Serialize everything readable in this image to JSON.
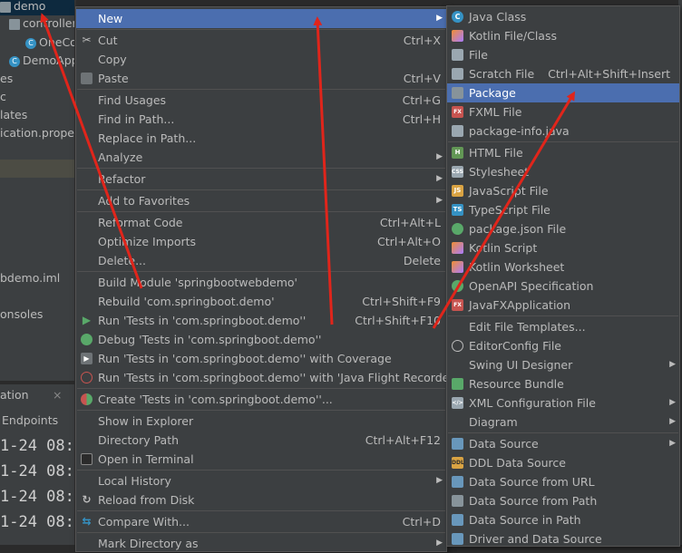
{
  "tree": {
    "rows": [
      {
        "label": "demo",
        "icon": "folder-icon"
      },
      {
        "label": "controller",
        "icon": "folder-icon"
      },
      {
        "label": "OneCo",
        "icon": "class-icon"
      },
      {
        "label": "DemoApp",
        "icon": "spring-class-icon"
      },
      {
        "label": "es",
        "icon": ""
      },
      {
        "label": "c",
        "icon": ""
      },
      {
        "label": "lates",
        "icon": ""
      },
      {
        "label": "ication.proper",
        "icon": ""
      },
      {
        "label": "bdemo.iml",
        "icon": ""
      },
      {
        "label": "onsoles",
        "icon": ""
      }
    ]
  },
  "bottom_panel": {
    "title": "ation",
    "close": "×",
    "endpoints": "Endpoints",
    "lines": [
      "1-24 08:",
      "1-24 08:",
      "1-24 08:",
      "1-24 08:"
    ]
  },
  "context_menu": {
    "items": [
      {
        "label": "New",
        "shortcut": "",
        "submenu": true,
        "icon": ""
      },
      {
        "label": "Cut",
        "shortcut": "Ctrl+X",
        "icon": "scissors-icon"
      },
      {
        "label": "Copy",
        "shortcut": "",
        "icon": ""
      },
      {
        "label": "Paste",
        "shortcut": "Ctrl+V",
        "icon": "paste-icon"
      },
      {
        "label": "Find Usages",
        "shortcut": "Ctrl+G",
        "icon": ""
      },
      {
        "label": "Find in Path...",
        "shortcut": "Ctrl+H",
        "icon": ""
      },
      {
        "label": "Replace in Path...",
        "shortcut": "",
        "icon": ""
      },
      {
        "label": "Analyze",
        "shortcut": "",
        "submenu": true,
        "icon": ""
      },
      {
        "label": "Refactor",
        "shortcut": "",
        "submenu": true,
        "icon": ""
      },
      {
        "label": "Add to Favorites",
        "shortcut": "",
        "submenu": true,
        "icon": ""
      },
      {
        "label": "Reformat Code",
        "shortcut": "Ctrl+Alt+L",
        "icon": ""
      },
      {
        "label": "Optimize Imports",
        "shortcut": "Ctrl+Alt+O",
        "icon": ""
      },
      {
        "label": "Delete...",
        "shortcut": "Delete",
        "icon": ""
      },
      {
        "label": "Build Module 'springbootwebdemo'",
        "shortcut": "",
        "icon": ""
      },
      {
        "label": "Rebuild 'com.springboot.demo'",
        "shortcut": "Ctrl+Shift+F9",
        "icon": ""
      },
      {
        "label": "Run 'Tests in 'com.springboot.demo''",
        "shortcut": "Ctrl+Shift+F10",
        "icon": "run-icon"
      },
      {
        "label": "Debug 'Tests in 'com.springboot.demo''",
        "shortcut": "",
        "icon": "debug-icon"
      },
      {
        "label": "Run 'Tests in 'com.springboot.demo'' with Coverage",
        "shortcut": "",
        "icon": "coverage-icon"
      },
      {
        "label": "Run 'Tests in 'com.springboot.demo'' with 'Java Flight Recorder'",
        "shortcut": "",
        "icon": "profiler-icon"
      },
      {
        "label": "Create 'Tests in 'com.springboot.demo''...",
        "shortcut": "",
        "icon": "create-test-icon"
      },
      {
        "label": "Show in Explorer",
        "shortcut": "",
        "icon": ""
      },
      {
        "label": "Directory Path",
        "shortcut": "Ctrl+Alt+F12",
        "icon": ""
      },
      {
        "label": "Open in Terminal",
        "shortcut": "",
        "icon": "terminal-icon"
      },
      {
        "label": "Local History",
        "shortcut": "",
        "submenu": true,
        "icon": ""
      },
      {
        "label": "Reload from Disk",
        "shortcut": "",
        "icon": "reload-icon"
      },
      {
        "label": "Compare With...",
        "shortcut": "Ctrl+D",
        "icon": "compare-icon"
      },
      {
        "label": "Mark Directory as",
        "shortcut": "",
        "submenu": true,
        "icon": ""
      }
    ]
  },
  "new_submenu": {
    "items": [
      {
        "label": "Java Class",
        "shortcut": "",
        "icon": "java-class-icon"
      },
      {
        "label": "Kotlin File/Class",
        "shortcut": "",
        "icon": "kotlin-file-icon"
      },
      {
        "label": "File",
        "shortcut": "",
        "icon": "file-icon"
      },
      {
        "label": "Scratch File",
        "shortcut": "Ctrl+Alt+Shift+Insert",
        "icon": "scratch-file-icon"
      },
      {
        "label": "Package",
        "shortcut": "",
        "icon": "package-icon"
      },
      {
        "label": "FXML File",
        "shortcut": "",
        "icon": "fxml-icon"
      },
      {
        "label": "package-info.java",
        "shortcut": "",
        "icon": "java-file-icon"
      },
      {
        "label": "HTML File",
        "shortcut": "",
        "icon": "html-icon"
      },
      {
        "label": "Stylesheet",
        "shortcut": "",
        "icon": "css-icon"
      },
      {
        "label": "JavaScript File",
        "shortcut": "",
        "icon": "js-icon"
      },
      {
        "label": "TypeScript File",
        "shortcut": "",
        "icon": "ts-icon"
      },
      {
        "label": "package.json File",
        "shortcut": "",
        "icon": "npm-icon"
      },
      {
        "label": "Kotlin Script",
        "shortcut": "",
        "icon": "kotlin-script-icon"
      },
      {
        "label": "Kotlin Worksheet",
        "shortcut": "",
        "icon": "kotlin-worksheet-icon"
      },
      {
        "label": "OpenAPI Specification",
        "shortcut": "",
        "icon": "openapi-icon"
      },
      {
        "label": "JavaFXApplication",
        "shortcut": "",
        "icon": "javafx-icon"
      },
      {
        "label": "Edit File Templates...",
        "shortcut": "",
        "icon": ""
      },
      {
        "label": "EditorConfig File",
        "shortcut": "",
        "icon": "editorconfig-icon"
      },
      {
        "label": "Swing UI Designer",
        "shortcut": "",
        "submenu": true,
        "icon": ""
      },
      {
        "label": "Resource Bundle",
        "shortcut": "",
        "icon": "resource-bundle-icon"
      },
      {
        "label": "XML Configuration File",
        "shortcut": "",
        "submenu": true,
        "icon": "xml-icon"
      },
      {
        "label": "Diagram",
        "shortcut": "",
        "submenu": true,
        "icon": ""
      },
      {
        "label": "Data Source",
        "shortcut": "",
        "submenu": true,
        "icon": "database-icon"
      },
      {
        "label": "DDL Data Source",
        "shortcut": "",
        "icon": "ddl-icon"
      },
      {
        "label": "Data Source from URL",
        "shortcut": "",
        "icon": "database-url-icon"
      },
      {
        "label": "Data Source from Path",
        "shortcut": "",
        "icon": "database-path-icon"
      },
      {
        "label": "Data Source in Path",
        "shortcut": "",
        "icon": "database-in-path-icon"
      },
      {
        "label": "Driver and Data Source",
        "shortcut": "",
        "icon": "driver-icon"
      }
    ]
  },
  "colors": {
    "menu_bg": "#3c3f41",
    "highlight": "#4b6eaf",
    "annotation_arrow": "#e0251b"
  }
}
